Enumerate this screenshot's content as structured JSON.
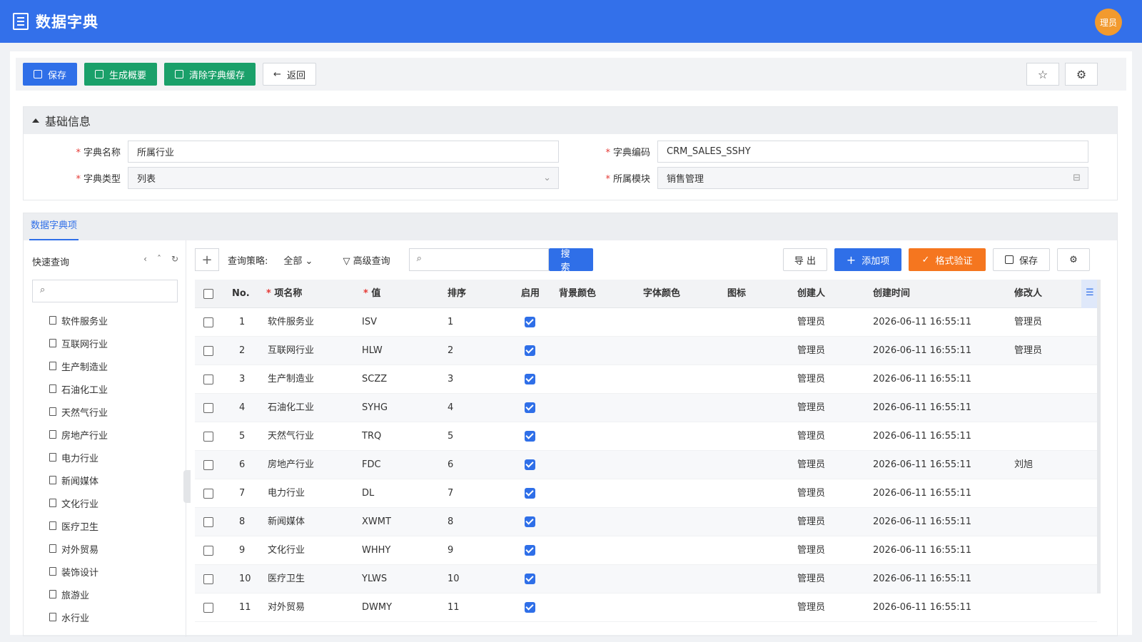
{
  "header": {
    "title": "数据字典",
    "avatar": "理员"
  },
  "toolbar": {
    "save": "保存",
    "summary": "生成概要",
    "clear_cache": "清除字典缓存",
    "back": "返回"
  },
  "basic": {
    "title": "基础信息",
    "name_label": "字典名称",
    "name_value": "所属行业",
    "code_label": "字典编码",
    "code_value": "CRM_SALES_SSHY",
    "type_label": "字典类型",
    "type_value": "列表",
    "module_label": "所属模块",
    "module_value": "销售管理"
  },
  "items": {
    "tab": "数据字典项",
    "quick_search": "快速查询",
    "tree": [
      "软件服务业",
      "互联网行业",
      "生产制造业",
      "石油化工业",
      "天然气行业",
      "房地产行业",
      "电力行业",
      "新闻媒体",
      "文化行业",
      "医疗卫生",
      "对外贸易",
      "装饰设计",
      "旅游业",
      "水行业"
    ],
    "strategy_label": "查询策略:",
    "strategy_value": "全部",
    "advanced": "高级查询",
    "search_btn": "搜 索",
    "export": "导 出",
    "add": "添加项",
    "validate": "格式验证",
    "save": "保存"
  },
  "table": {
    "columns": {
      "no": "No.",
      "name": "项名称",
      "value": "值",
      "sort": "排序",
      "enabled": "启用",
      "bg": "背景颜色",
      "font": "字体颜色",
      "icon": "图标",
      "creator": "创建人",
      "created": "创建时间",
      "modifier": "修改人"
    },
    "rows": [
      {
        "no": "1",
        "name": "软件服务业",
        "value": "ISV",
        "sort": "1",
        "creator": "管理员",
        "created": "2026-06-11 16:55:11",
        "modifier": "管理员"
      },
      {
        "no": "2",
        "name": "互联网行业",
        "value": "HLW",
        "sort": "2",
        "creator": "管理员",
        "created": "2026-06-11 16:55:11",
        "modifier": "管理员"
      },
      {
        "no": "3",
        "name": "生产制造业",
        "value": "SCZZ",
        "sort": "3",
        "creator": "管理员",
        "created": "2026-06-11 16:55:11",
        "modifier": ""
      },
      {
        "no": "4",
        "name": "石油化工业",
        "value": "SYHG",
        "sort": "4",
        "creator": "管理员",
        "created": "2026-06-11 16:55:11",
        "modifier": ""
      },
      {
        "no": "5",
        "name": "天然气行业",
        "value": "TRQ",
        "sort": "5",
        "creator": "管理员",
        "created": "2026-06-11 16:55:11",
        "modifier": ""
      },
      {
        "no": "6",
        "name": "房地产行业",
        "value": "FDC",
        "sort": "6",
        "creator": "管理员",
        "created": "2026-06-11 16:55:11",
        "modifier": "刘旭"
      },
      {
        "no": "7",
        "name": "电力行业",
        "value": "DL",
        "sort": "7",
        "creator": "管理员",
        "created": "2026-06-11 16:55:11",
        "modifier": ""
      },
      {
        "no": "8",
        "name": "新闻媒体",
        "value": "XWMT",
        "sort": "8",
        "creator": "管理员",
        "created": "2026-06-11 16:55:11",
        "modifier": ""
      },
      {
        "no": "9",
        "name": "文化行业",
        "value": "WHHY",
        "sort": "9",
        "creator": "管理员",
        "created": "2026-06-11 16:55:11",
        "modifier": ""
      },
      {
        "no": "10",
        "name": "医疗卫生",
        "value": "YLWS",
        "sort": "10",
        "creator": "管理员",
        "created": "2026-06-11 16:55:11",
        "modifier": ""
      },
      {
        "no": "11",
        "name": "对外贸易",
        "value": "DWMY",
        "sort": "11",
        "creator": "管理员",
        "created": "2026-06-11 16:55:11",
        "modifier": ""
      }
    ]
  }
}
